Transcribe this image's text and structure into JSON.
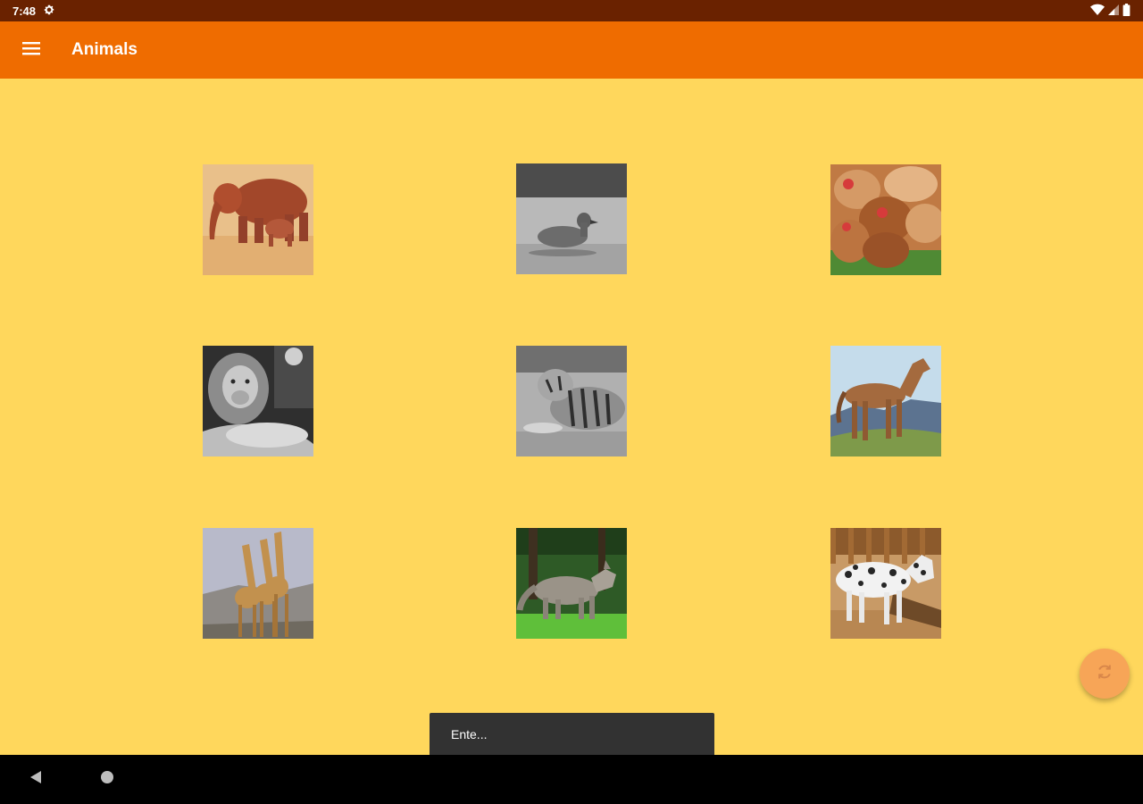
{
  "status_bar": {
    "time": "7:48"
  },
  "app_bar": {
    "title": "Animals"
  },
  "tiles": [
    {
      "animal": "elephant"
    },
    {
      "animal": "duck"
    },
    {
      "animal": "chickens"
    },
    {
      "animal": "lion"
    },
    {
      "animal": "tiger"
    },
    {
      "animal": "horse"
    },
    {
      "animal": "giraffes"
    },
    {
      "animal": "wolf"
    },
    {
      "animal": "spotted-pony"
    }
  ],
  "snackbar": {
    "text": "Ente..."
  },
  "icons": {
    "menu": "menu-icon",
    "settings": "gear-icon",
    "wifi": "wifi-icon",
    "signal": "signal-icon",
    "battery": "battery-icon",
    "refresh": "refresh-icon",
    "back": "back-icon",
    "home": "home-icon"
  },
  "colors": {
    "status_bar": "#6A2200",
    "app_bar": "#EF6C00",
    "background": "#FFD75C",
    "fab": "#F7A557",
    "snackbar": "#323232",
    "nav_bar": "#000000"
  }
}
